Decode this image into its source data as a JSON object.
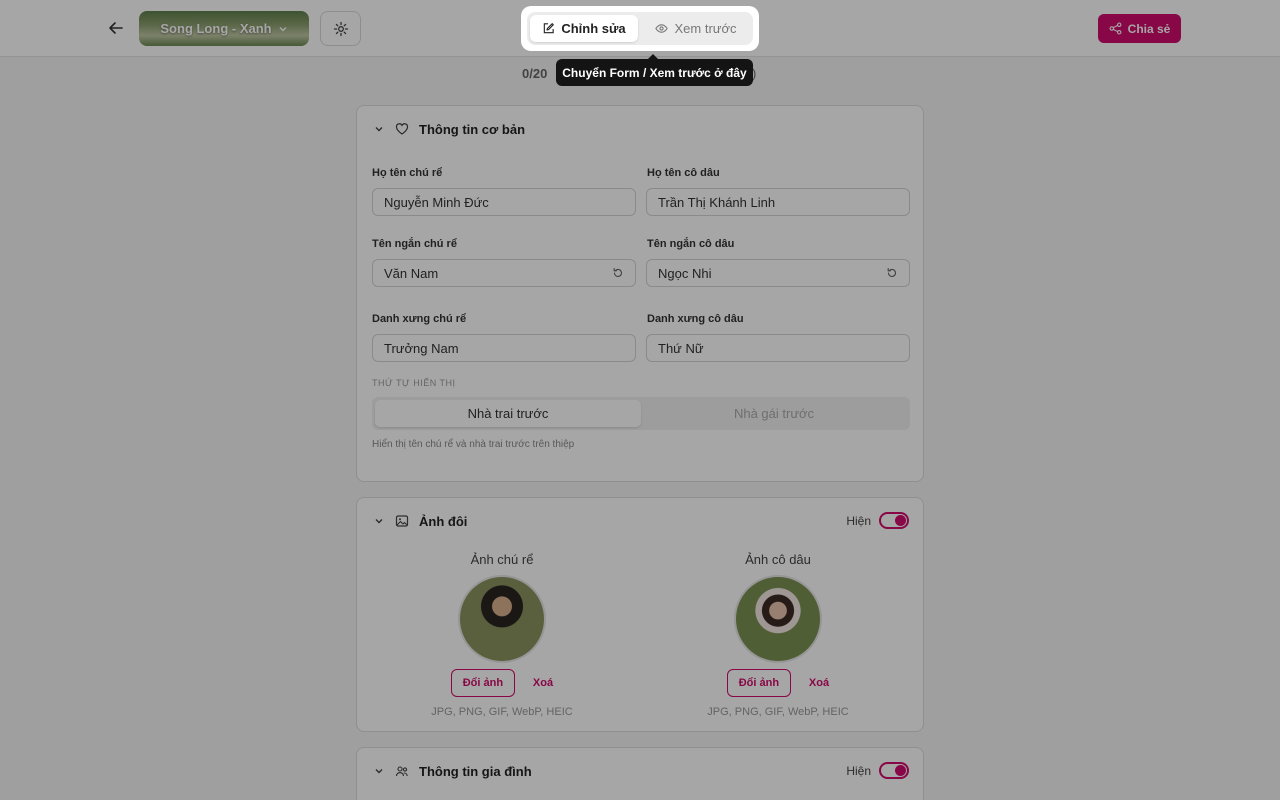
{
  "header": {
    "template_name": "Song Long - Xanh",
    "share_label": "Chia sẻ"
  },
  "mode_toggle": {
    "edit_label": "Chỉnh sửa",
    "preview_label": "Xem trước",
    "tooltip": "Chuyển Form / Xem trước ở đây"
  },
  "progress": {
    "count": "0/20",
    "tail": ")"
  },
  "basic_info": {
    "title": "Thông tin cơ bản",
    "groom_name_label": "Họ tên chú rể",
    "groom_name": "Nguyễn Minh Đức",
    "bride_name_label": "Họ tên cô dâu",
    "bride_name": "Trần Thị Khánh Linh",
    "groom_short_label": "Tên ngắn chú rể",
    "groom_short": "Văn Nam",
    "bride_short_label": "Tên ngắn cô dâu",
    "bride_short": "Ngọc Nhi",
    "groom_title_label": "Danh xưng chú rể",
    "groom_title": "Trưởng Nam",
    "bride_title_label": "Danh xưng cô dâu",
    "bride_title": "Thứ Nữ",
    "order_caption": "THỨ TỰ HIỂN THỊ",
    "order_groom_first": "Nhà trai trước",
    "order_bride_first": "Nhà gái trước",
    "order_hint": "Hiển thị tên chú rể và nhà trai trước trên thiệp"
  },
  "couple_photos": {
    "title": "Ảnh đôi",
    "show_label": "Hiện",
    "groom_label": "Ảnh chú rể",
    "bride_label": "Ảnh cô dâu",
    "change_label": "Đổi ảnh",
    "delete_label": "Xoá",
    "formats": "JPG, PNG, GIF, WebP, HEIC"
  },
  "family_info": {
    "title": "Thông tin gia đình",
    "show_label": "Hiện"
  },
  "colors": {
    "accent": "#d10c6c"
  }
}
